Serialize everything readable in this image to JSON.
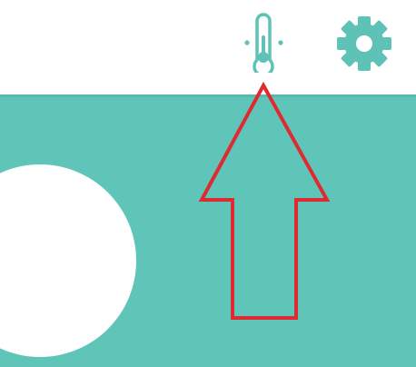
{
  "header": {
    "thermometer_button": {
      "icon": "thermometer-icon"
    },
    "settings_button": {
      "icon": "gear-icon"
    }
  },
  "colors": {
    "accent": "#5fc5b8",
    "icon": "#5ec3b6",
    "background": "#ffffff",
    "annotation": "#e02a32"
  }
}
